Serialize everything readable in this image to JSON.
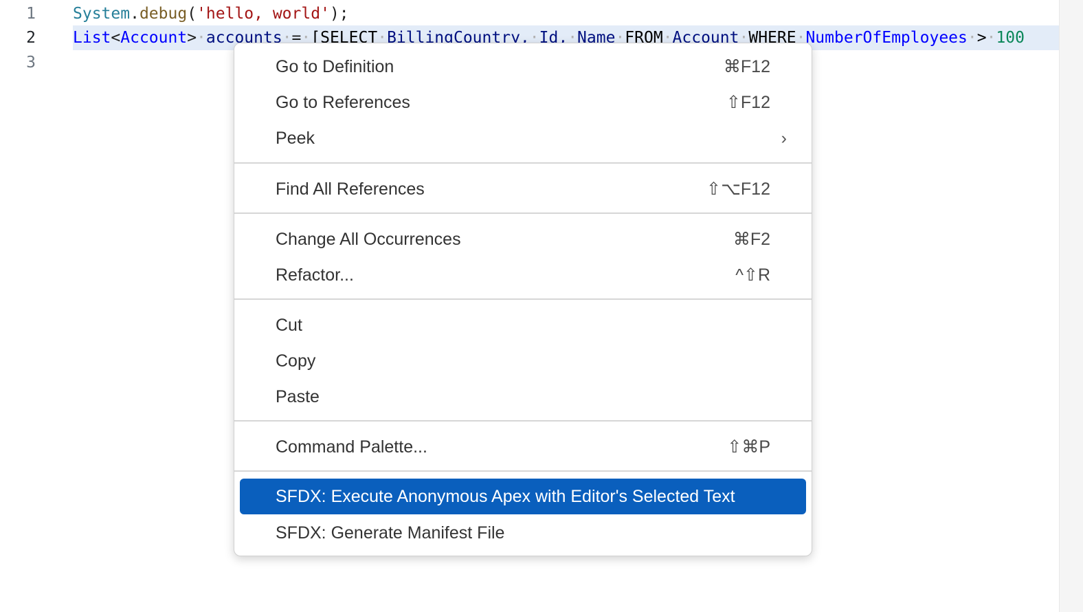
{
  "editor": {
    "line_numbers": [
      "1",
      "2",
      "3"
    ],
    "line1": {
      "t1": "System",
      "t2": ".",
      "t3": "debug",
      "t4": "(",
      "t5": "'hello, world'",
      "t6": ");"
    },
    "line2": {
      "t1": "List",
      "t2": "<",
      "t3": "Account",
      "t4": ">",
      "t5": "accounts",
      "t6": "=",
      "t7": "[SELECT",
      "t8": "BillingCountry,",
      "t9": "Id,",
      "t10": "Name",
      "t11": "FROM",
      "t12": "Account",
      "t13": "WHERE",
      "t14": "NumberOfEmployees",
      "t15": ">",
      "t16": "100",
      "ws": "·"
    }
  },
  "context_menu": {
    "go_to_definition": {
      "label": "Go to Definition",
      "shortcut": "⌘F12"
    },
    "go_to_references": {
      "label": "Go to References",
      "shortcut": "⇧F12"
    },
    "peek": {
      "label": "Peek",
      "chevron": "›"
    },
    "find_all_references": {
      "label": "Find All References",
      "shortcut": "⇧⌥F12"
    },
    "change_all_occurrences": {
      "label": "Change All Occurrences",
      "shortcut": "⌘F2"
    },
    "refactor": {
      "label": "Refactor...",
      "shortcut": "^⇧R"
    },
    "cut": {
      "label": "Cut"
    },
    "copy": {
      "label": "Copy"
    },
    "paste": {
      "label": "Paste"
    },
    "command_palette": {
      "label": "Command Palette...",
      "shortcut": "⇧⌘P"
    },
    "sfdx_execute": {
      "label": "SFDX: Execute Anonymous Apex with Editor's Selected Text"
    },
    "sfdx_manifest": {
      "label": "SFDX: Generate Manifest File"
    }
  },
  "colors": {
    "highlight": "#0a5fbd",
    "selection": "#e3ecf8"
  }
}
